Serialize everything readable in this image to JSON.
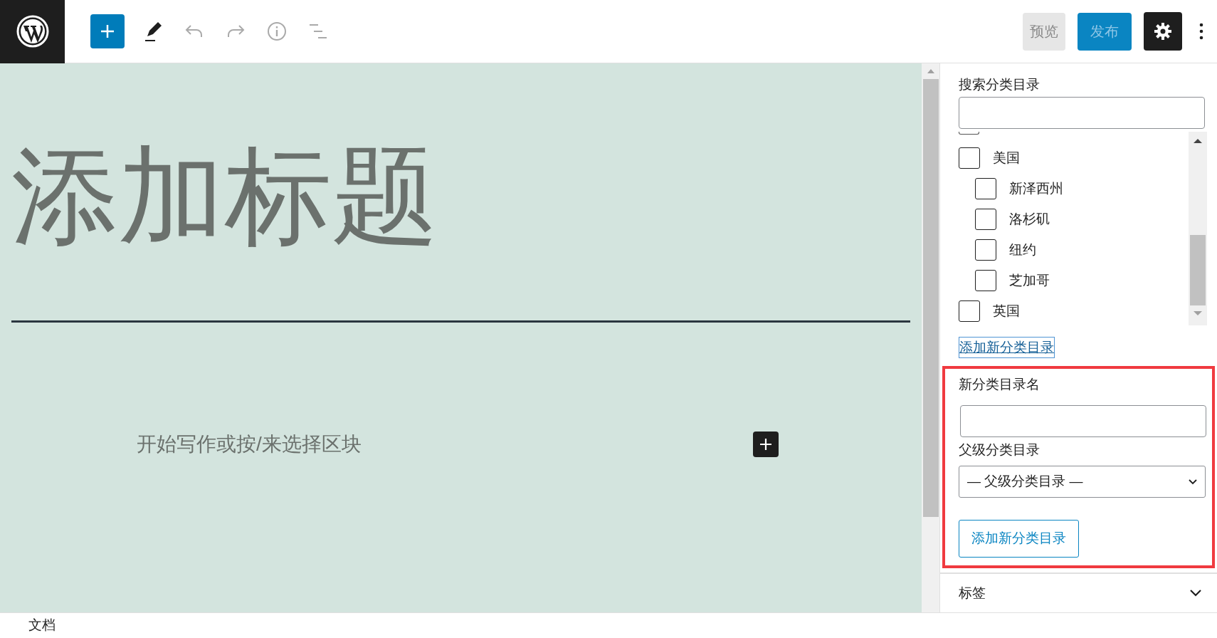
{
  "toolbar": {
    "preview": "预览",
    "publish": "发布",
    "settings_selected": true
  },
  "editor": {
    "title_placeholder": "添加标题",
    "body_placeholder": "开始写作或按/来选择区块"
  },
  "categories": {
    "search_label": "搜索分类目录",
    "items": [
      {
        "label": "美国",
        "checked": false,
        "children": [
          {
            "label": "新泽西州",
            "checked": false
          },
          {
            "label": "洛杉矶",
            "checked": false
          },
          {
            "label": "纽约",
            "checked": false
          },
          {
            "label": "芝加哥",
            "checked": false
          }
        ]
      },
      {
        "label": "英国",
        "checked": false
      }
    ],
    "add_link": "添加新分类目录",
    "new_name_label": "新分类目录名",
    "parent_label": "父级分类目录",
    "parent_value": "— 父级分类目录 —",
    "add_button": "添加新分类目录"
  },
  "tags_panel": {
    "title": "标签",
    "expanded": false
  },
  "footer": {
    "breadcrumb": "文档"
  }
}
